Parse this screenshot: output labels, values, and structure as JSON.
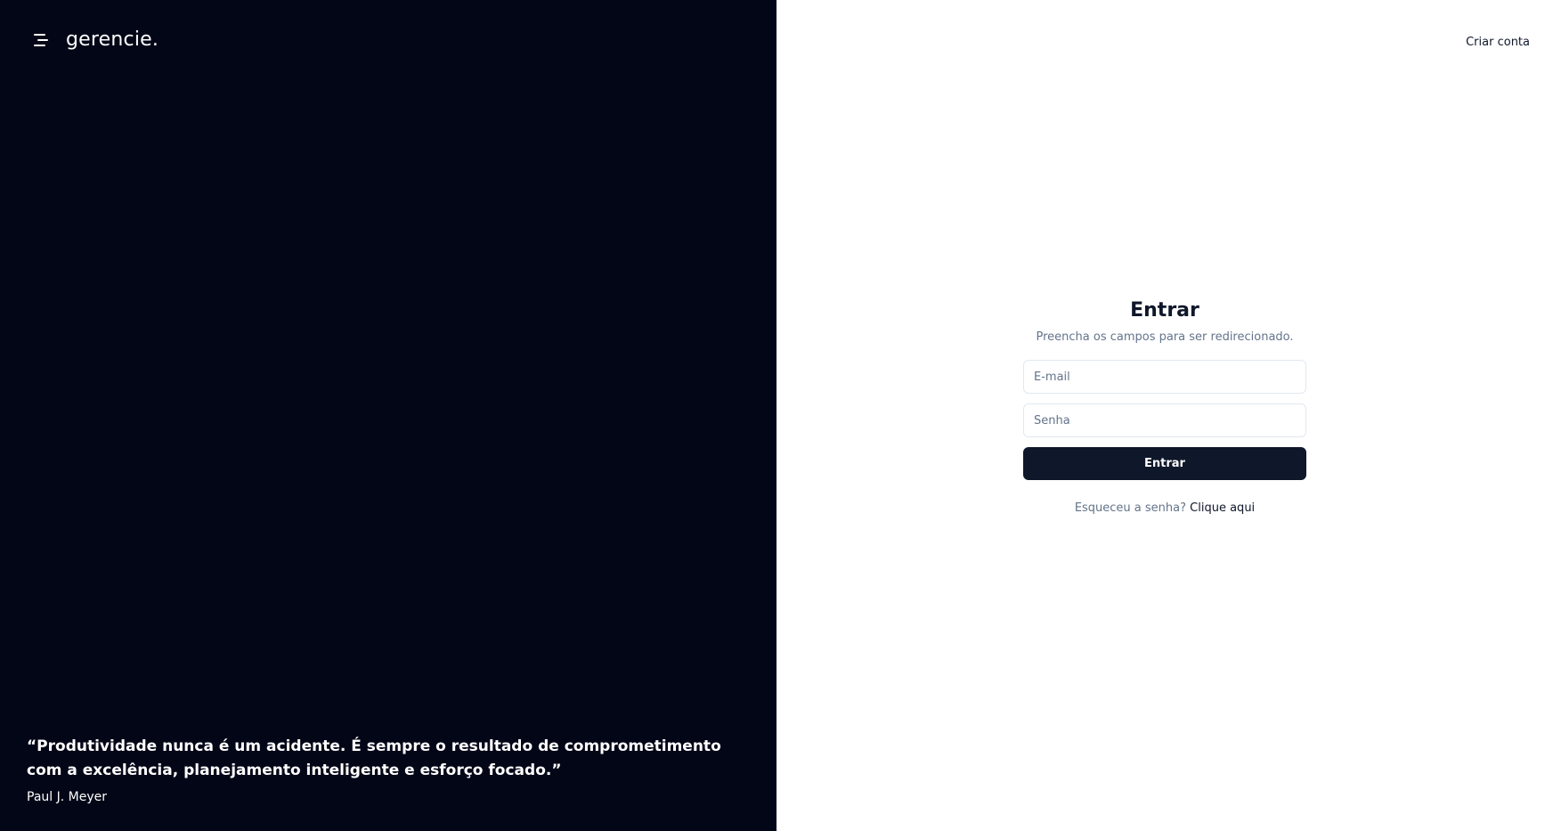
{
  "brand": {
    "name": "gerencie.",
    "menu_icon": "menu-icon"
  },
  "quote": {
    "text": "“Produtividade nunca é um acidente. É sempre o resultado de comprometimento com a excelência, planejamento inteligente e esforço focado.”",
    "author": "Paul J. Meyer"
  },
  "header": {
    "create_account_label": "Criar conta"
  },
  "login": {
    "title": "Entrar",
    "subtitle": "Preencha os campos para ser redirecionado.",
    "email": {
      "placeholder": "E-mail",
      "value": ""
    },
    "password": {
      "placeholder": "Senha",
      "value": ""
    },
    "submit_label": "Entrar",
    "forgot_text": "Esqueceu a senha?",
    "forgot_link": "Clique aqui"
  },
  "colors": {
    "left_panel_bg": "#020617",
    "primary_button": "#0f172a",
    "muted_text": "#64748b",
    "input_border": "#e2e8f0"
  }
}
